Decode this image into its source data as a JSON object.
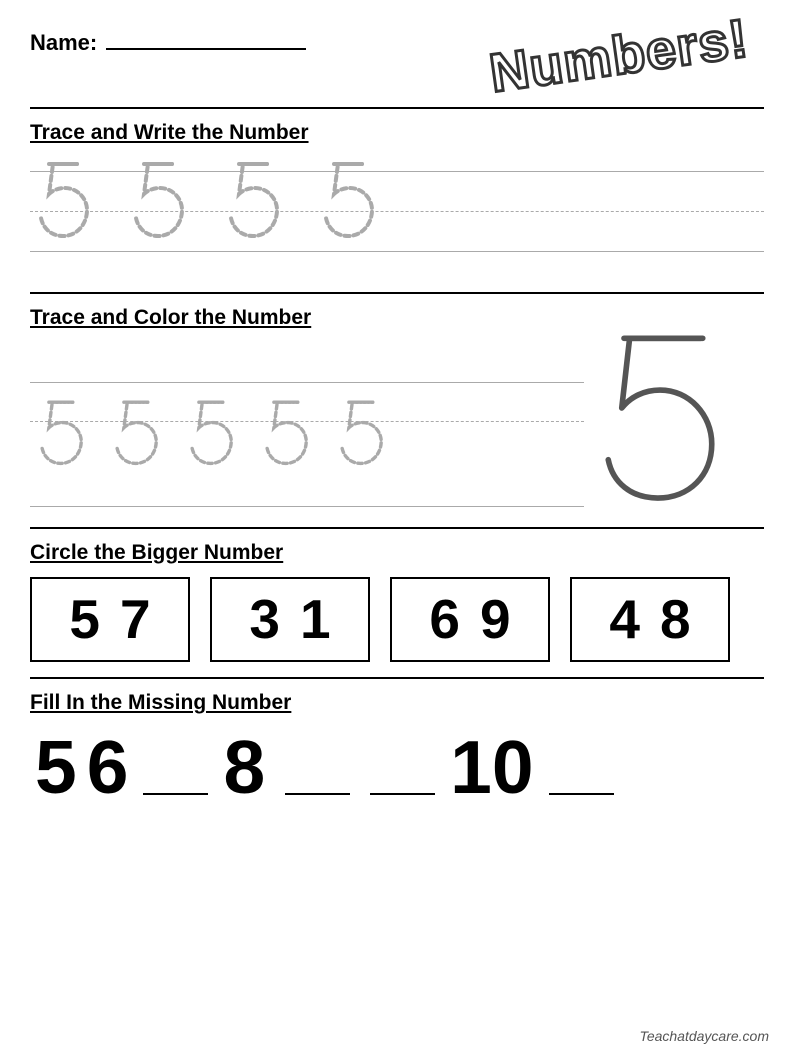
{
  "header": {
    "name_label": "Name:",
    "title": "Numbers!"
  },
  "section1": {
    "title": "Trace and Write the Number",
    "numbers": [
      "5",
      "5",
      "5",
      "5"
    ]
  },
  "section2": {
    "title": "Trace and Color the Number",
    "numbers": [
      "5",
      "5",
      "5",
      "5",
      "5"
    ],
    "big_number": "5"
  },
  "section3": {
    "title": "Circle the Bigger Number",
    "pairs": [
      {
        "left": "5",
        "right": "7"
      },
      {
        "left": "3",
        "right": "1"
      },
      {
        "left": "6",
        "right": "9"
      },
      {
        "left": "4",
        "right": "8"
      }
    ]
  },
  "section4": {
    "title": "Fill In the Missing Number",
    "sequence": [
      "5",
      "6",
      "_",
      "8",
      "_",
      "_",
      "10",
      "_"
    ]
  },
  "watermark": "Teachatdaycare.com"
}
